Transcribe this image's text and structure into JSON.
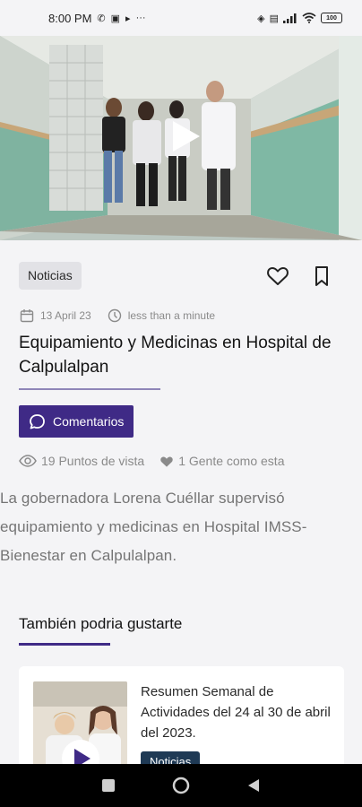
{
  "status_bar": {
    "time": "8:00 PM",
    "more": "···",
    "battery": "100"
  },
  "icons": {
    "play": "play-icon",
    "heart": "heart-icon",
    "bookmark": "bookmark-icon",
    "calendar": "calendar-icon",
    "clock": "clock-icon",
    "comment": "comment-icon",
    "eye": "eye-icon"
  },
  "colors": {
    "accent": "#3f2a86",
    "tag_bg": "#e2e2e6",
    "related_tag_bg": "#1f3a55"
  },
  "article": {
    "category": "Noticias",
    "date": "13 April 23",
    "read_time": "less than a minute",
    "title": "Equipamiento y Medicinas en Hospital de Calpulalpan",
    "comments_label": "Comentarios",
    "views": "19 Puntos de vista",
    "likes": "1 Gente como esta",
    "summary": "La gobernadora Lorena Cuéllar supervisó equipamiento y medicinas en Hospital IMSS-Bienestar en Calpulalpan."
  },
  "related": {
    "section_title": "También podria gustarte",
    "items": [
      {
        "title": "Resumen Semanal de Actividades del 24 al 30 de abril del 2023.",
        "category": "Noticias"
      }
    ]
  }
}
